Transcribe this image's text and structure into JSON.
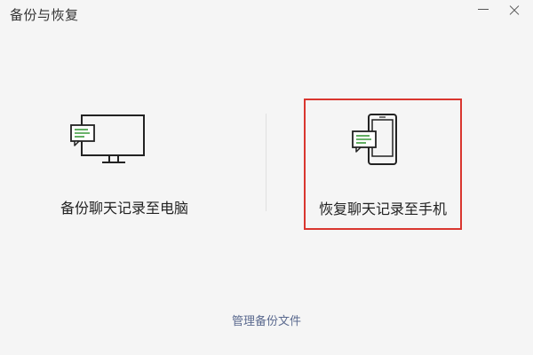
{
  "window": {
    "title": "备份与恢复",
    "minimize_icon": "minimize-icon",
    "close_icon": "close-icon"
  },
  "options": {
    "backup_to_pc": {
      "label": "备份聊天记录至电脑",
      "icon": "monitor-chat-icon"
    },
    "restore_to_phone": {
      "label": "恢复聊天记录至手机",
      "icon": "phone-chat-icon",
      "highlighted": true
    }
  },
  "footer": {
    "manage_label": "管理备份文件"
  },
  "colors": {
    "background": "#f5f5f5",
    "highlight_border": "#d9362f",
    "chat_bubble": "#3a9a3a",
    "link": "#5b6a8f"
  }
}
